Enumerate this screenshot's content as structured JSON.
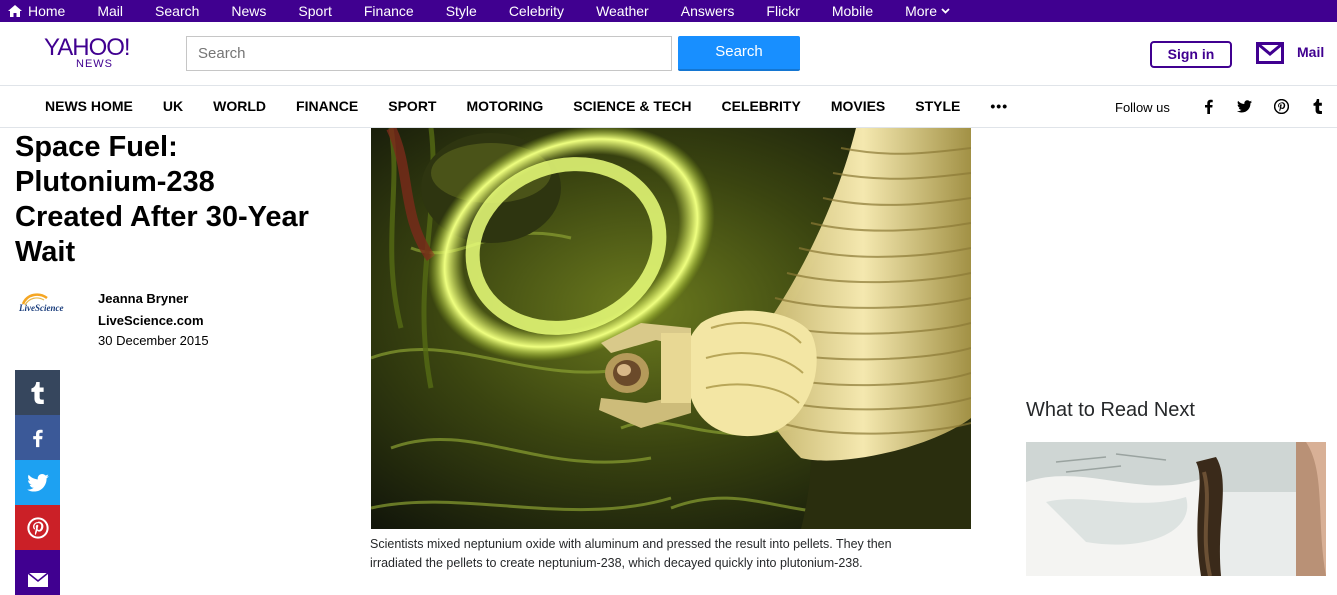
{
  "topbar": {
    "items": [
      "Home",
      "Mail",
      "Search",
      "News",
      "Sport",
      "Finance",
      "Style",
      "Celebrity",
      "Weather",
      "Answers",
      "Flickr",
      "Mobile",
      "More"
    ]
  },
  "header": {
    "logo_text": "YAHOO!",
    "logo_sub": "NEWS",
    "search_placeholder": "Search",
    "search_button": "Search",
    "signin": "Sign in",
    "mail": "Mail"
  },
  "nav": {
    "items": [
      "NEWS HOME",
      "UK",
      "WORLD",
      "FINANCE",
      "SPORT",
      "MOTORING",
      "SCIENCE & TECH",
      "CELEBRITY",
      "MOVIES",
      "STYLE"
    ],
    "more": "•••",
    "follow": "Follow us"
  },
  "article": {
    "title": "Space Fuel: Plutonium-238 Created After 30-Year Wait",
    "provider_logo": "LiveScience",
    "author": "Jeanna Bryner",
    "provider": "LiveScience.com",
    "date": "30 December 2015",
    "caption": "Scientists mixed neptunium oxide with aluminum and pressed the result into pellets. They then irradiated the pellets to create neptunium-238, which decayed quickly into plutonium-238."
  },
  "sidebar": {
    "heading": "What to Read Next"
  },
  "colors": {
    "brand": "#400090",
    "search_blue": "#188fff"
  }
}
